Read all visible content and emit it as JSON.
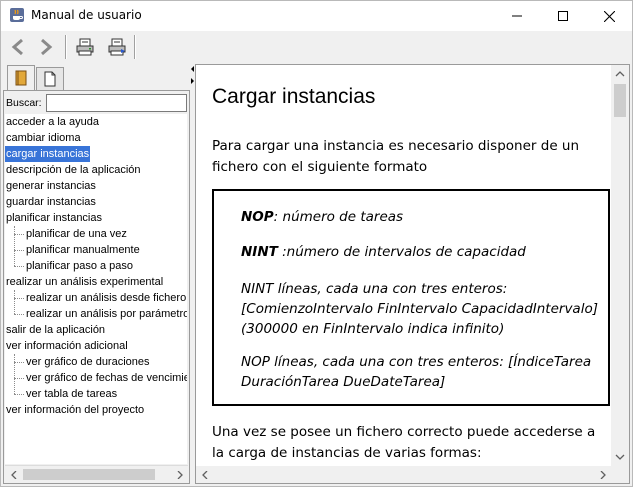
{
  "window": {
    "title": "Manual de usuario",
    "icon": "java-cup-icon"
  },
  "toolbar": {
    "buttons": [
      {
        "icon": "back-arrow-icon"
      },
      {
        "icon": "forward-arrow-icon"
      },
      {
        "icon": "print-icon"
      },
      {
        "icon": "page-setup-icon"
      }
    ]
  },
  "tabs": [
    {
      "icon": "book-icon",
      "active": true
    },
    {
      "icon": "document-icon",
      "active": false
    }
  ],
  "search": {
    "label": "Buscar:",
    "value": ""
  },
  "tree": {
    "items": [
      {
        "label": "acceder a la ayuda",
        "level": 0
      },
      {
        "label": "cambiar idioma",
        "level": 0
      },
      {
        "label": "cargar instancias",
        "level": 0,
        "selected": true
      },
      {
        "label": "descripción de la aplicación",
        "level": 0
      },
      {
        "label": "generar instancias",
        "level": 0
      },
      {
        "label": "guardar instancias",
        "level": 0
      },
      {
        "label": "planificar instancias",
        "level": 0
      },
      {
        "label": "planificar de una vez",
        "level": 1
      },
      {
        "label": "planificar manualmente",
        "level": 1
      },
      {
        "label": "planificar paso a paso",
        "level": 1
      },
      {
        "label": "realizar un análisis experimental",
        "level": 0
      },
      {
        "label": "realizar un análisis desde fichero",
        "level": 1
      },
      {
        "label": "realizar un análisis por parámetros",
        "level": 1
      },
      {
        "label": "salir de la aplicación",
        "level": 0
      },
      {
        "label": "ver información adicional",
        "level": 0
      },
      {
        "label": "ver gráfico de duraciones",
        "level": 1
      },
      {
        "label": "ver gráfico de fechas de vencimie",
        "level": 1
      },
      {
        "label": "ver tabla de tareas",
        "level": 1
      },
      {
        "label": "ver información del proyecto",
        "level": 0
      }
    ]
  },
  "content": {
    "title": "Cargar instancias",
    "intro": "Para cargar una instancia es necesario disponer de un fichero con el siguiente formato",
    "format": {
      "nop_key": "NOP",
      "nop_desc": ": número de tareas",
      "nint_key": "NINT",
      "nint_desc": " :número de intervalos de capacidad",
      "nint_lines_1": "NINT líneas, cada una con tres enteros:",
      "nint_lines_2": "[ComienzoIntervalo FinIntervalo CapacidadIntervalo]",
      "nint_lines_3": "(300000 en FinIntervalo indica infinito)",
      "nop_lines_1": "NOP líneas, cada una con tres enteros: [ÍndiceTarea",
      "nop_lines_2": "DuraciónTarea DueDateTarea]"
    },
    "outro": "Una vez se posee un fichero correcto puede accederse a la carga de instancias de varias formas:"
  }
}
